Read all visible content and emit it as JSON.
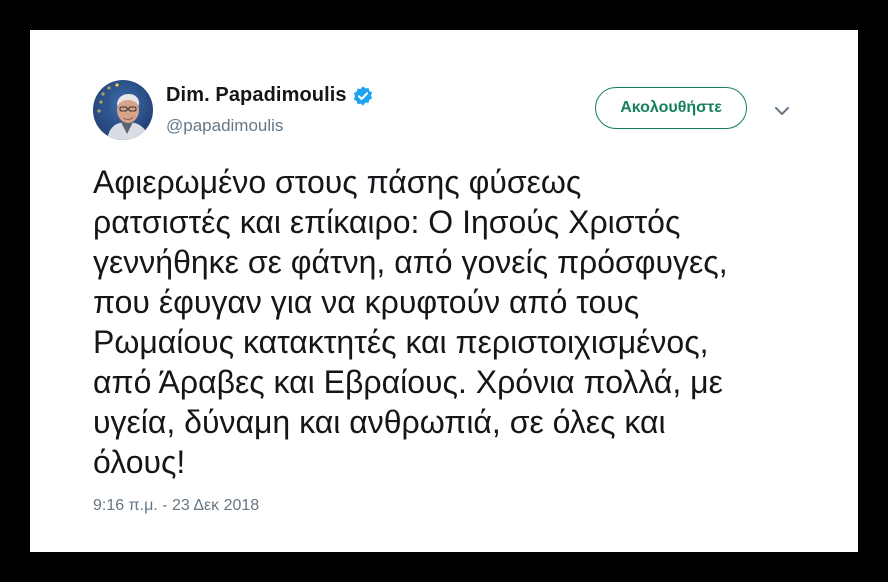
{
  "user": {
    "display_name": "Dim. Papadimoulis",
    "handle": "@papadimoulis",
    "verified": true,
    "verified_icon": "verified-badge-icon",
    "avatar": "profile-photo"
  },
  "follow_button": {
    "label": "Ακολουθήστε"
  },
  "menu_icon": "chevron-down-icon",
  "tweet": {
    "lines": [
      "Αφιερωμένο στους πάσης φύσεως",
      "ρατσιστές και επίκαιρο: Ο Ιησούς Χριστός",
      "γεννήθηκε σε φάτνη, από γονείς πρόσφυγες,",
      "που έφυγαν για να κρυφτούν από τους",
      "Ρωμαίους κατακτητές και περιστοιχισμένος,",
      "από Άραβες και Εβραίους. Χρόνια πολλά, με",
      "υγεία, δύναμη και ανθρωπιά, σε όλες και",
      "όλους!"
    ],
    "timestamp": "9:16 π.μ. - 23 Δεκ 2018"
  },
  "colors": {
    "follow_green": "#17805e",
    "verified_blue": "#1da1f2",
    "muted_text": "#657786",
    "text": "#14171a"
  }
}
